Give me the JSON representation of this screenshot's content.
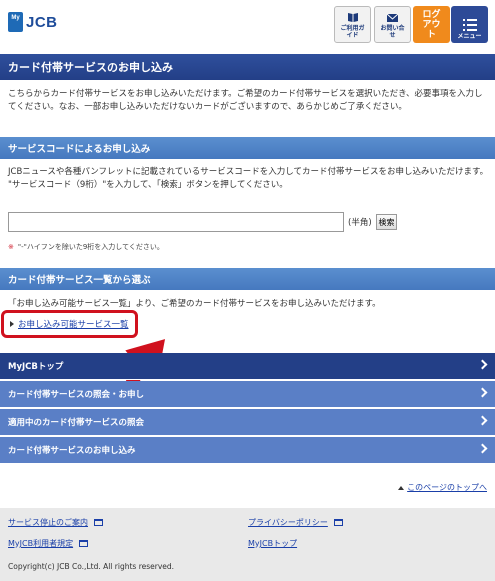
{
  "header": {
    "logo_small": "My",
    "logo_text": "JCB",
    "guide_label": "ご利用ガイド",
    "inquiry_label": "お問い合せ",
    "logout_label": "ログアウト",
    "menu_label": "メニュー"
  },
  "page": {
    "title": "カード付帯サービスのお申し込み",
    "intro": "こちらからカード付帯サービスをお申し込みいただけます。ご希望のカード付帯サービスを選択いただき、必要事項を入力してください。なお、一部お申し込みいただけないカードがございますので、あらかじめご了承ください。"
  },
  "service_code": {
    "heading": "サービスコードによるお申し込み",
    "text1": "JCBニュースや各種パンフレットに記載されているサービスコードを入力してカード付帯サービスをお申し込みいただけます。",
    "text2": "\"サービスコード（9桁）\"を入力して、「検索」ボタンを押してください。",
    "input_value": "",
    "unit": "(半角)",
    "search_label": "検索",
    "note_mark": "※",
    "note": "\"-\"ハイフンを除いた9桁を入力してください。"
  },
  "service_list": {
    "heading": "カード付帯サービス一覧から選ぶ",
    "text": "「お申し込み可能サービス一覧」より、ご希望のカード付帯サービスをお申し込みいただけます。",
    "link": "お申し込み可能サービス一覧"
  },
  "nav": [
    {
      "label": "MyJCBトップ"
    },
    {
      "label": "カード付帯サービスの照会・お申し"
    },
    {
      "label": "適用中のカード付帯サービスの照会"
    },
    {
      "label": "カード付帯サービスのお申し込み"
    }
  ],
  "pagetop": "このページのトップへ",
  "footer": {
    "links": [
      {
        "label": "サービス停止のご案内"
      },
      {
        "label": "プライバシーポリシー"
      },
      {
        "label": "MyJCB利用者規定"
      },
      {
        "label": "MyJCBトップ"
      }
    ],
    "copyright": "Copyright(c) JCB Co.,Ltd. All rights reserved."
  },
  "colors": {
    "primary_navy": "#233f87",
    "section_blue": "#4679bf",
    "nav_light": "#5a7fc6",
    "logout_orange": "#f08a1c",
    "highlight_red": "#d0111e",
    "link_blue": "#1a3fa8"
  },
  "icons": {
    "guide": "book-icon",
    "inquiry": "mail-icon",
    "menu": "hamburger-icon",
    "new_window": "new-window-icon",
    "annotation": "red-arrow-icon"
  }
}
